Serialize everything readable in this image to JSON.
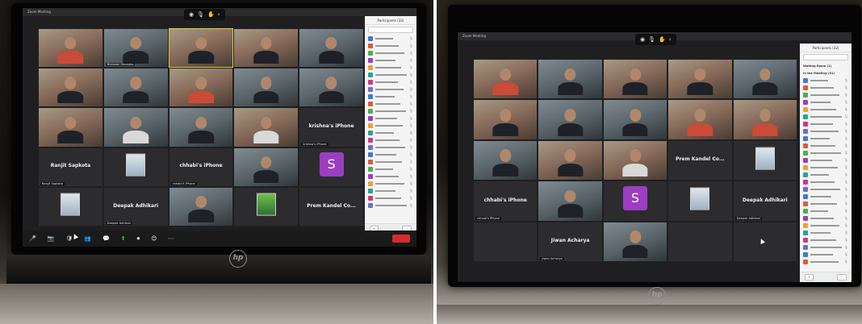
{
  "left": {
    "window_title": "Zoom Meeting",
    "panel_title": "Participants (32)",
    "tiles": [
      {
        "kind": "video",
        "tone": "warm",
        "shirt": "red",
        "name": ""
      },
      {
        "kind": "video",
        "tone": "cool",
        "shirt": "dark",
        "name": "Bhimsen Shrestha"
      },
      {
        "kind": "video",
        "tone": "warm",
        "shirt": "dark",
        "name": ""
      },
      {
        "kind": "video",
        "tone": "warm",
        "shirt": "dark",
        "name": ""
      },
      {
        "kind": "video",
        "tone": "cool",
        "shirt": "dark",
        "name": ""
      },
      {
        "kind": "video",
        "tone": "warm",
        "shirt": "dark",
        "name": ""
      },
      {
        "kind": "video",
        "tone": "cool",
        "shirt": "dark",
        "name": ""
      },
      {
        "kind": "video",
        "tone": "warm",
        "shirt": "red",
        "name": ""
      },
      {
        "kind": "video",
        "tone": "cool",
        "shirt": "dark",
        "name": ""
      },
      {
        "kind": "video",
        "tone": "cool",
        "shirt": "dark",
        "name": ""
      },
      {
        "kind": "video",
        "tone": "warm",
        "shirt": "dark",
        "name": ""
      },
      {
        "kind": "video",
        "tone": "cool",
        "shirt": "white",
        "name": ""
      },
      {
        "kind": "video",
        "tone": "cool",
        "shirt": "dark",
        "name": ""
      },
      {
        "kind": "video",
        "tone": "warm",
        "shirt": "white",
        "name": ""
      },
      {
        "kind": "name",
        "label": "krishna's iPhone",
        "name": "krishna's iPhone"
      },
      {
        "kind": "name",
        "label": "Ranjit Sapkota",
        "name": "Ranjit Sapkota"
      },
      {
        "kind": "thumb",
        "name": ""
      },
      {
        "kind": "name",
        "label": "chhabi's iPhone",
        "name": "chhabi's iPhone"
      },
      {
        "kind": "video",
        "tone": "cool",
        "shirt": "dark",
        "name": ""
      },
      {
        "kind": "avatar",
        "letter": "S",
        "name": ""
      },
      {
        "kind": "thumb",
        "name": ""
      },
      {
        "kind": "name",
        "label": "Deepak Adhikari",
        "name": "Deepak Adhikari"
      },
      {
        "kind": "video",
        "tone": "cool",
        "shirt": "dark",
        "name": ""
      },
      {
        "kind": "thumbgreen",
        "name": ""
      },
      {
        "kind": "name",
        "label": "Prem Kandel Co...",
        "name": ""
      }
    ],
    "controls": [
      {
        "icon": "🎤",
        "label": ""
      },
      {
        "icon": "📷",
        "label": ""
      },
      {
        "icon": "🛡",
        "label": ""
      },
      {
        "icon": "👥",
        "label": ""
      },
      {
        "icon": "💬",
        "label": ""
      },
      {
        "icon": "⬆",
        "label": ""
      },
      {
        "icon": "⏺",
        "label": ""
      },
      {
        "icon": "😊",
        "label": ""
      },
      {
        "icon": "⋯",
        "label": ""
      }
    ]
  },
  "right": {
    "window_title": "Zoom Meeting",
    "panel_title": "Participants (32)",
    "panel_section_1": "Waiting Room (1)",
    "panel_section_2": "In the Meeting (31)",
    "tiles": [
      {
        "kind": "video",
        "tone": "warm",
        "shirt": "red",
        "name": ""
      },
      {
        "kind": "video",
        "tone": "cool",
        "shirt": "dark",
        "name": ""
      },
      {
        "kind": "video",
        "tone": "warm",
        "shirt": "dark",
        "name": ""
      },
      {
        "kind": "video",
        "tone": "warm",
        "shirt": "dark",
        "name": ""
      },
      {
        "kind": "video",
        "tone": "cool",
        "shirt": "dark",
        "name": ""
      },
      {
        "kind": "video",
        "tone": "warm",
        "shirt": "dark",
        "name": ""
      },
      {
        "kind": "video",
        "tone": "cool",
        "shirt": "dark",
        "name": ""
      },
      {
        "kind": "video",
        "tone": "cool",
        "shirt": "dark",
        "name": ""
      },
      {
        "kind": "video",
        "tone": "warm",
        "shirt": "red",
        "name": ""
      },
      {
        "kind": "video",
        "tone": "warm",
        "shirt": "red",
        "name": ""
      },
      {
        "kind": "video",
        "tone": "cool",
        "shirt": "dark",
        "name": ""
      },
      {
        "kind": "video",
        "tone": "warm",
        "shirt": "dark",
        "name": ""
      },
      {
        "kind": "video",
        "tone": "warm",
        "shirt": "white",
        "name": ""
      },
      {
        "kind": "name",
        "label": "Prem Kandel Co...",
        "name": ""
      },
      {
        "kind": "thumb",
        "name": ""
      },
      {
        "kind": "name",
        "label": "chhabi's iPhone",
        "name": "chhabi's iPhone"
      },
      {
        "kind": "video",
        "tone": "cool",
        "shirt": "dark",
        "name": ""
      },
      {
        "kind": "avatar",
        "letter": "S",
        "name": ""
      },
      {
        "kind": "thumb",
        "name": ""
      },
      {
        "kind": "name",
        "label": "Deepak Adhikari",
        "name": "Deepak Adhikari"
      },
      {
        "kind": "empty",
        "name": ""
      },
      {
        "kind": "name",
        "label": "Jiwan Acharya",
        "name": "Jiwan Acharya"
      },
      {
        "kind": "video",
        "tone": "cool",
        "shirt": "dark",
        "name": ""
      },
      {
        "kind": "empty",
        "name": ""
      },
      {
        "kind": "empty",
        "name": ""
      }
    ]
  },
  "colors": {
    "panel_avatars": [
      "#3b7bd8",
      "#e05a3a",
      "#4caf50",
      "#9b3ec1",
      "#f0a030",
      "#2aa198",
      "#d33682",
      "#6c71c4"
    ]
  },
  "brand": "hp"
}
